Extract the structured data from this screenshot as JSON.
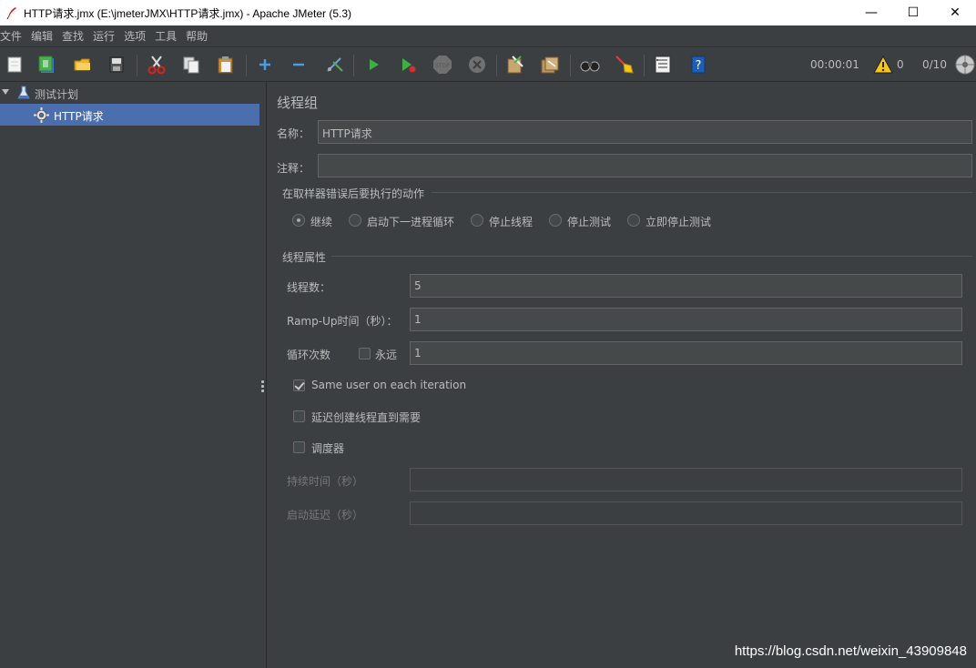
{
  "window": {
    "title": "HTTP请求.jmx (E:\\jmeterJMX\\HTTP请求.jmx) - Apache JMeter (5.3)",
    "minimize": "—",
    "maximize": "☐",
    "close": "✕"
  },
  "menu": [
    "文件",
    "编辑",
    "查找",
    "运行",
    "选项",
    "工具",
    "帮助"
  ],
  "toolbar": {
    "icons": [
      "new-icon",
      "templates-icon",
      "open-icon",
      "save-icon",
      "cut-icon",
      "copy-icon",
      "paste-icon",
      "expand-icon",
      "collapse-icon",
      "toggle-icon",
      "start-icon",
      "start-no-pause-icon",
      "stop-icon",
      "shutdown-icon",
      "clear-icon",
      "clear-all-icon",
      "search-icon",
      "reset-search-icon",
      "function-helper-icon",
      "help-icon"
    ],
    "timer": "00:00:01",
    "warning_count": "0",
    "threads": "0/10"
  },
  "tree": {
    "root_label": "测试计划",
    "child_label": "HTTP请求"
  },
  "form": {
    "heading": "线程组",
    "name_label": "名称：",
    "name_value": "HTTP请求",
    "comment_label": "注释：",
    "comment_value": "",
    "error_action_title": "在取样器错误后要执行的动作",
    "error_actions": [
      "继续",
      "启动下一进程循环",
      "停止线程",
      "停止测试",
      "立即停止测试"
    ],
    "error_action_selected": "继续",
    "thread_props_title": "线程属性",
    "threads_label": "线程数：",
    "threads_value": "5",
    "rampup_label": "Ramp-Up时间（秒）：",
    "rampup_value": "1",
    "loop_label": "循环次数",
    "forever_label": "永远",
    "loop_value": "1",
    "same_user_label": "Same user on each iteration",
    "same_user_checked": true,
    "delay_label": "延迟创建线程直到需要",
    "scheduler_label": "调度器",
    "duration_label": "持续时间（秒）",
    "duration_value": "",
    "startup_delay_label": "启动延迟（秒）",
    "startup_delay_value": ""
  },
  "watermark": "https://blog.csdn.net/weixin_43909848",
  "colors": {
    "background": "#3c3f41",
    "selection": "#4b6eaf",
    "text": "#bbbbbb",
    "field": "#45494a"
  }
}
